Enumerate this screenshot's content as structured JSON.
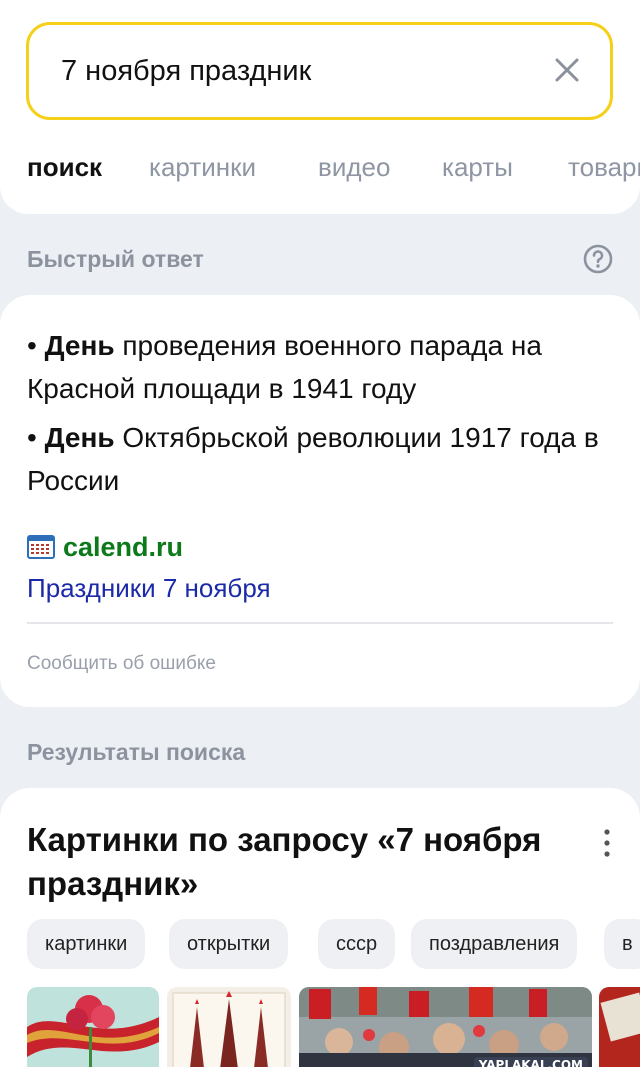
{
  "search": {
    "query": "7 ноября праздник"
  },
  "tabs": [
    {
      "label": "поиск",
      "active": true
    },
    {
      "label": "картинки",
      "active": false
    },
    {
      "label": "видео",
      "active": false
    },
    {
      "label": "карты",
      "active": false
    },
    {
      "label": "товары",
      "active": false
    }
  ],
  "quick_answer": {
    "header": "Быстрый ответ",
    "facts": [
      {
        "bold": "День",
        "text": " проведения военного парада на Красной площади в 1941 году"
      },
      {
        "bold": "День",
        "text": " Октябрьской революции 1917 года в России"
      }
    ],
    "bullet": "•",
    "source_site": "calend.ru",
    "source_title": "Праздники 7 ноября",
    "report_error": "Сообщить об ошибке"
  },
  "results": {
    "header": "Результаты поиска",
    "images_block_title": "Картинки по запросу «7 ноября праздник»",
    "chips": [
      "картинки",
      "открытки",
      "ссср",
      "поздравления",
      "в"
    ],
    "watermark": "YAPLAKAL.COM"
  },
  "colors": {
    "accent": "#f5d018",
    "link": "#1b2aa8",
    "source": "#0c7a1a",
    "background": "#eceff4"
  }
}
